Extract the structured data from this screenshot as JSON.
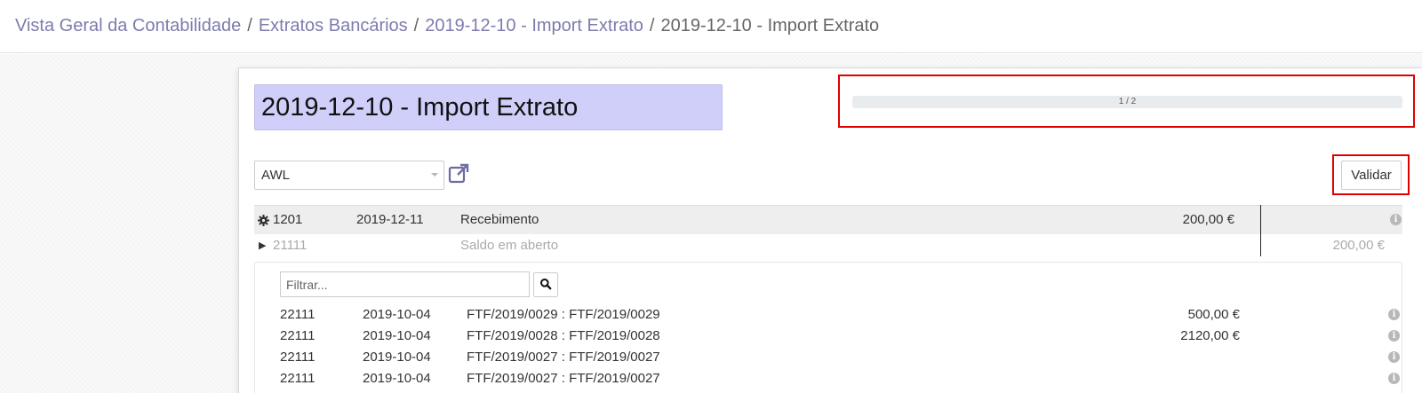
{
  "breadcrumb": {
    "items": [
      "Vista Geral da Contabilidade",
      "Extratos Bancários",
      "2019-12-10 - Import Extrato"
    ],
    "current": "2019-12-10 - Import Extrato",
    "separator": "/"
  },
  "statement": {
    "title": "2019-12-10 - Import Extrato"
  },
  "progress": {
    "label": "1 / 2",
    "done": 1,
    "total": 2
  },
  "partner": {
    "value": "AWL",
    "external_link_icon": "external-link-icon"
  },
  "toolbar": {
    "validate_label": "Validar"
  },
  "statement_line": {
    "ref": "1201",
    "date": "2019-12-11",
    "label": "Recebimento",
    "amount": "200,00 €",
    "gear_icon": "gear-icon",
    "info_icon": "info-icon"
  },
  "open_balance": {
    "account": "21111",
    "label": "Saldo em aberto",
    "amount": "200,00 €",
    "expand_icon": "triangle-right-icon"
  },
  "filter": {
    "placeholder": "Filtrar...",
    "search_icon": "search-icon"
  },
  "propositions": [
    {
      "account": "22111",
      "date": "2019-10-04",
      "label": "FTF/2019/0029 : FTF/2019/0029",
      "amount": "500,00 €"
    },
    {
      "account": "22111",
      "date": "2019-10-04",
      "label": "FTF/2019/0028 : FTF/2019/0028",
      "amount": "2120,00 €"
    },
    {
      "account": "22111",
      "date": "2019-10-04",
      "label": "FTF/2019/0027 : FTF/2019/0027",
      "amount": ""
    },
    {
      "account": "22111",
      "date": "2019-10-04",
      "label": "FTF/2019/0027 : FTF/2019/0027",
      "amount": ""
    }
  ],
  "colors": {
    "title_highlight": "#cfcffa",
    "breadcrumb_link": "#7c7bad",
    "annotation_red": "#e00000"
  }
}
